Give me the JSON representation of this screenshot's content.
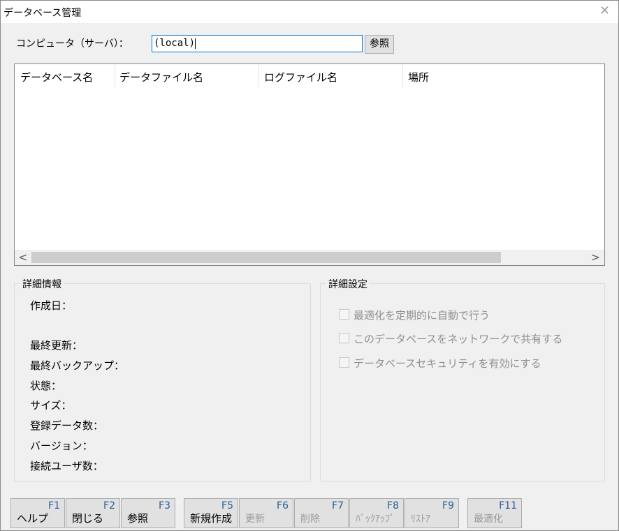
{
  "window": {
    "title": "データベース管理"
  },
  "computer": {
    "label": "コンピュータ（サーバ）：",
    "value": "(local)",
    "browse_label": "参照"
  },
  "list": {
    "columns": [
      "データベース名",
      "データファイル名",
      "ログファイル名",
      "場所"
    ],
    "rows": []
  },
  "details": {
    "title": "詳細情報",
    "fields": {
      "created": "作成日：",
      "last_updated": "最終更新：",
      "last_backup": "最終バックアップ：",
      "state": "状態：",
      "size": "サイズ：",
      "record_count": "登録データ数：",
      "version": "バージョン：",
      "connected_users": "接続ユーザ数："
    }
  },
  "settings": {
    "title": "詳細設定",
    "options": {
      "auto_optimize": "最適化を定期的に自動で行う",
      "share_network": "このデータベースをネットワークで共有する",
      "enable_security": "データベースセキュリティを有効にする"
    }
  },
  "fkeys": {
    "f1": {
      "key": "F1",
      "label": "ヘルプ"
    },
    "f2": {
      "key": "F2",
      "label": "閉じる"
    },
    "f3": {
      "key": "F3",
      "label": "参照"
    },
    "f5": {
      "key": "F5",
      "label": "新規作成"
    },
    "f6": {
      "key": "F6",
      "label": "更新"
    },
    "f7": {
      "key": "F7",
      "label": "削除"
    },
    "f8": {
      "key": "F8",
      "label": "ﾊﾞｯｸｱｯﾌﾟ"
    },
    "f9": {
      "key": "F9",
      "label": "ﾘｽﾄｱ"
    },
    "f11": {
      "key": "F11",
      "label": "最適化"
    }
  },
  "colors": {
    "accent": "#0078d7",
    "fkey_text": "#2a5c9a",
    "disabled_text": "#9a9a9a"
  }
}
